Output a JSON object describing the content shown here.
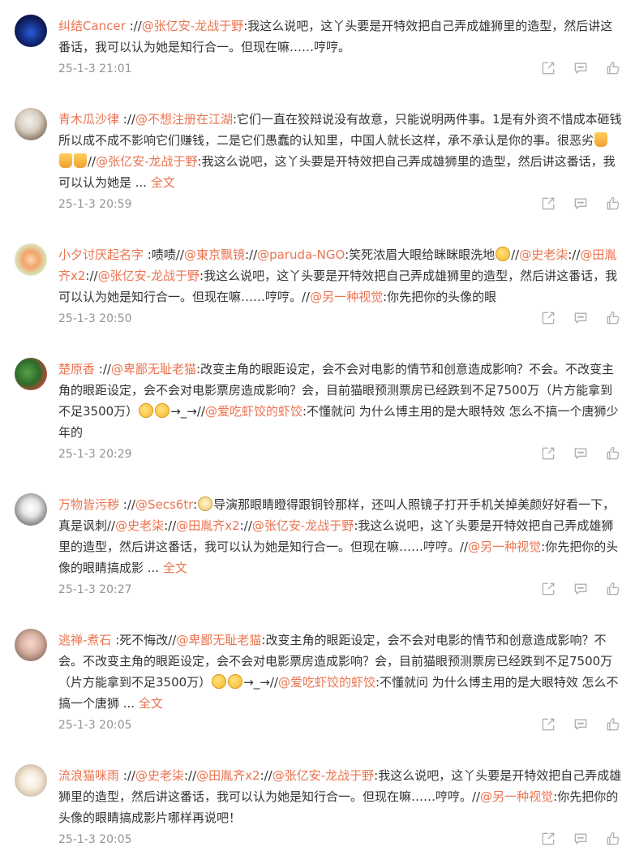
{
  "comments": [
    {
      "user": "纠结Cancer",
      "body": ":// @张亿安-龙战于野 :我这么说吧，这丫头要是开特效把自己弄成雄狮里的造型，然后讲这番话，我可以认为她是知行合一。但现在嘛……哼哼。",
      "segments": [
        {
          "t": "text",
          "v": "://"
        },
        {
          "t": "at",
          "v": "@张亿安-龙战于野"
        },
        {
          "t": "text",
          "v": ":我这么说吧，这丫头要是开特效把自己弄成雄狮里的造型，然后讲这番话，我可以认为她是知行合一。但现在嘛……哼哼。"
        }
      ],
      "time": "25-1-3 21:01"
    },
    {
      "user": "青木瓜沙律",
      "segments": [
        {
          "t": "text",
          "v": "://"
        },
        {
          "t": "at",
          "v": "@不想注册在江湖"
        },
        {
          "t": "text",
          "v": ":它们一直在狡辩说没有故意，只能说明两件事。1是有外资不惜成本砸钱所以成不成不影响它们赚钱，二是它们愚蠢的认知里，中国人就长这样，承不承认是你的事。很恶劣"
        },
        {
          "t": "emoji",
          "v": "thumb-down"
        },
        {
          "t": "emoji",
          "v": "thumb-down"
        },
        {
          "t": "emoji",
          "v": "thumb-down"
        },
        {
          "t": "text",
          "v": "//"
        },
        {
          "t": "at",
          "v": "@张亿安-龙战于野"
        },
        {
          "t": "text",
          "v": ":我这么说吧，这丫头要是开特效把自己弄成雄狮里的造型，然后讲这番话，我可以认为她是 ... "
        },
        {
          "t": "more",
          "v": "全文"
        }
      ],
      "time": "25-1-3 20:59"
    },
    {
      "user": "小夕讨厌起名字",
      "segments": [
        {
          "t": "text",
          "v": ":啧啧//"
        },
        {
          "t": "at",
          "v": "@東京飘镜"
        },
        {
          "t": "text",
          "v": "://"
        },
        {
          "t": "at",
          "v": "@paruda-NGO"
        },
        {
          "t": "text",
          "v": ":笑死浓眉大眼给眯眯眼洗地"
        },
        {
          "t": "emoji",
          "v": "laugh-cry"
        },
        {
          "t": "text",
          "v": "//"
        },
        {
          "t": "at",
          "v": "@史老柒"
        },
        {
          "t": "text",
          "v": "://"
        },
        {
          "t": "at",
          "v": "@田胤齐x2"
        },
        {
          "t": "text",
          "v": "://"
        },
        {
          "t": "at",
          "v": "@张亿安-龙战于野"
        },
        {
          "t": "text",
          "v": ":我这么说吧，这丫头要是开特效把自己弄成雄狮里的造型，然后讲这番话，我可以认为她是知行合一。但现在嘛……哼哼。//"
        },
        {
          "t": "at",
          "v": "@另一种视觉"
        },
        {
          "t": "text",
          "v": ":你先把你的头像的眼"
        }
      ],
      "time": "25-1-3 20:50"
    },
    {
      "user": "楚原香",
      "segments": [
        {
          "t": "text",
          "v": "://"
        },
        {
          "t": "at",
          "v": "@卑鄙无耻老猫"
        },
        {
          "t": "text",
          "v": ":改变主角的眼距设定，会不会对电影的情节和创意造成影响？不会。不改变主角的眼距设定，会不会对电影票房造成影响？会，目前猫眼预测票房已经跌到不足7500万（片方能拿到不足3500万）"
        },
        {
          "t": "emoji",
          "v": "laugh-cry"
        },
        {
          "t": "emoji",
          "v": "laugh-cry"
        },
        {
          "t": "text",
          "v": "→_→//"
        },
        {
          "t": "at",
          "v": "@爱吃虾饺的虾饺"
        },
        {
          "t": "text",
          "v": ":不懂就问 为什么博主用的是大眼特效 怎么不搞一个唐狮少年的"
        }
      ],
      "time": "25-1-3 20:29"
    },
    {
      "user": "万物皆污秽",
      "segments": [
        {
          "t": "text",
          "v": "://"
        },
        {
          "t": "at",
          "v": "@Secs6tr"
        },
        {
          "t": "text",
          "v": ":"
        },
        {
          "t": "emoji",
          "v": "cat"
        },
        {
          "t": "text",
          "v": "导演那眼睛瞪得跟铜铃那样，还叫人照镜子打开手机关掉美颜好好看一下，真是讽刺//"
        },
        {
          "t": "at",
          "v": "@史老柒"
        },
        {
          "t": "text",
          "v": "://"
        },
        {
          "t": "at",
          "v": "@田胤齐x2"
        },
        {
          "t": "text",
          "v": "://"
        },
        {
          "t": "at",
          "v": "@张亿安-龙战于野"
        },
        {
          "t": "text",
          "v": ":我这么说吧，这丫头要是开特效把自己弄成雄狮里的造型，然后讲这番话，我可以认为她是知行合一。但现在嘛……哼哼。//"
        },
        {
          "t": "at",
          "v": "@另一种视觉"
        },
        {
          "t": "text",
          "v": ":你先把你的头像的眼睛搞成影 ... "
        },
        {
          "t": "more",
          "v": "全文"
        }
      ],
      "time": "25-1-3 20:27"
    },
    {
      "user": "逃禅-煮石",
      "segments": [
        {
          "t": "text",
          "v": ":死不悔改//"
        },
        {
          "t": "at",
          "v": "@卑鄙无耻老猫"
        },
        {
          "t": "text",
          "v": ":改变主角的眼距设定，会不会对电影的情节和创意造成影响？不会。不改变主角的眼距设定，会不会对电影票房造成影响？会，目前猫眼预测票房已经跌到不足7500万（片方能拿到不足3500万）"
        },
        {
          "t": "emoji",
          "v": "laugh-cry"
        },
        {
          "t": "emoji",
          "v": "laugh-cry"
        },
        {
          "t": "text",
          "v": "→_→//"
        },
        {
          "t": "at",
          "v": "@爱吃虾饺的虾饺"
        },
        {
          "t": "text",
          "v": ":不懂就问 为什么博主用的是大眼特效 怎么不搞一个唐狮 ... "
        },
        {
          "t": "more",
          "v": "全文"
        }
      ],
      "time": "25-1-3 20:05"
    },
    {
      "user": "流浪猫咪雨",
      "segments": [
        {
          "t": "text",
          "v": "://"
        },
        {
          "t": "at",
          "v": "@史老柒"
        },
        {
          "t": "text",
          "v": "://"
        },
        {
          "t": "at",
          "v": "@田胤齐x2"
        },
        {
          "t": "text",
          "v": "://"
        },
        {
          "t": "at",
          "v": "@张亿安-龙战于野"
        },
        {
          "t": "text",
          "v": ":我这么说吧，这丫头要是开特效把自己弄成雄狮里的造型，然后讲这番话，我可以认为她是知行合一。但现在嘛……哼哼。//"
        },
        {
          "t": "at",
          "v": "@另一种视觉"
        },
        {
          "t": "text",
          "v": ":你先把你的头像的眼睛搞成影片哪样再说吧！"
        }
      ],
      "time": "25-1-3 20:05"
    }
  ],
  "actions": {
    "forward_icon": "forward-icon",
    "comment_icon": "comment-icon",
    "like_icon": "like-icon"
  },
  "colors": {
    "username": "#eb7350",
    "mention": "#eb7350",
    "time": "#939393",
    "text": "#333333",
    "icon": "#b0b0b0"
  }
}
